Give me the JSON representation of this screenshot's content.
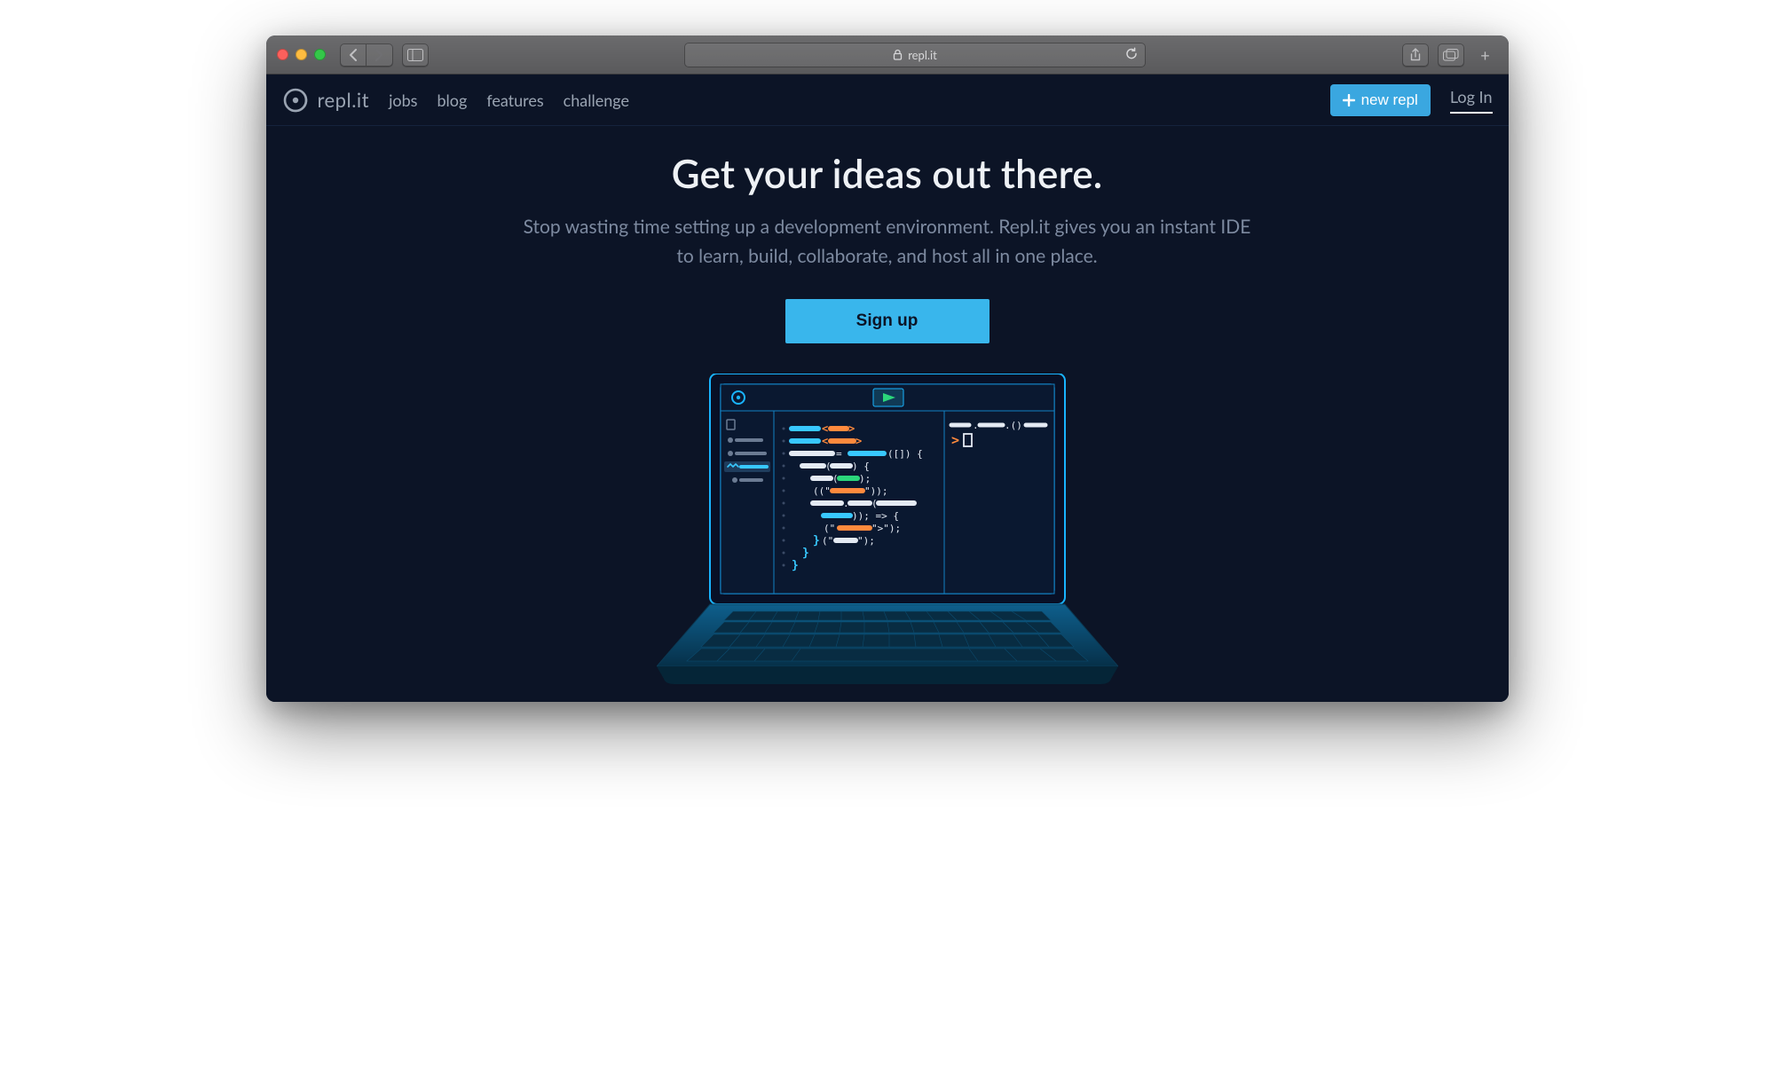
{
  "browser": {
    "address": "repl.it"
  },
  "nav": {
    "brand": "repl.it",
    "links": {
      "jobs": "jobs",
      "blog": "blog",
      "features": "features",
      "challenge": "challenge"
    },
    "new_repl": "new repl",
    "login": "Log In"
  },
  "hero": {
    "headline": "Get your ideas out there.",
    "sub": "Stop wasting time setting up a development environment. Repl.it gives you an instant IDE to learn, build, collaborate, and host all in one place.",
    "cta": "Sign up"
  }
}
